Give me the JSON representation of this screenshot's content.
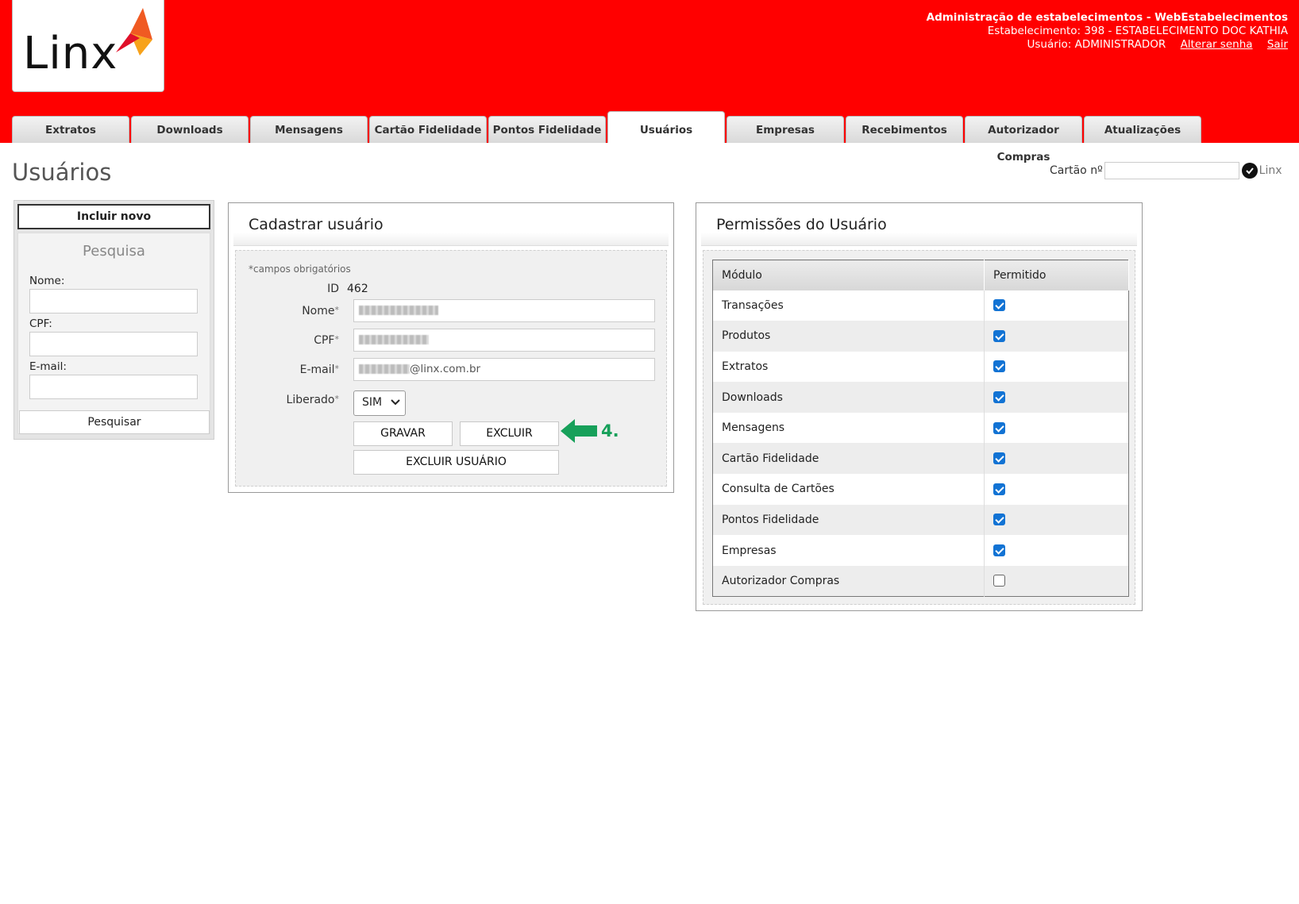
{
  "header": {
    "logo_text": "Linx",
    "title": "Administração de estabelecimentos - WebEstabelecimentos",
    "estabelecimento": "Estabelecimento: 398 - ESTABELECIMENTO DOC KATHIA",
    "usuario": "Usuário: ADMINISTRADOR",
    "alterar_senha": "Alterar senha",
    "sair": "Sair",
    "brand_color": "#ff0000"
  },
  "tabs": [
    {
      "label": "Extratos"
    },
    {
      "label": "Downloads"
    },
    {
      "label": "Mensagens"
    },
    {
      "label": "Cartão Fidelidade"
    },
    {
      "label": "Pontos Fidelidade"
    },
    {
      "label": "Usuários",
      "active": true
    },
    {
      "label": "Empresas"
    },
    {
      "label": "Recebimentos"
    },
    {
      "label": "Autorizador Compras"
    },
    {
      "label": "Atualizações"
    }
  ],
  "page": {
    "title": "Usuários",
    "cartao_label": "Cartão nº",
    "mini_logo": "Linx"
  },
  "sidebar": {
    "incluir_novo": "Incluir novo",
    "pesquisa_title": "Pesquisa",
    "nome_label": "Nome:",
    "cpf_label": "CPF:",
    "email_label": "E-mail:",
    "pesquisar_button": "Pesquisar"
  },
  "cadastro": {
    "title": "Cadastrar usuário",
    "obrigatorios": "*campos obrigatórios",
    "id_label": "ID",
    "id_value": "462",
    "nome_label": "Nome",
    "cpf_label": "CPF",
    "email_label": "E-mail",
    "email_suffix": "@linx.com.br",
    "liberado_label": "Liberado",
    "liberado_value": "SIM",
    "required_mark": "*",
    "gravar": "GRAVAR",
    "excluir": "EXCLUIR",
    "excluir_usuario": "EXCLUIR USUÁRIO",
    "annotation": "4.",
    "annotation_color": "#17a05a"
  },
  "permissoes": {
    "title": "Permissões do Usuário",
    "col_modulo": "Módulo",
    "col_permitido": "Permitido",
    "rows": [
      {
        "modulo": "Transações",
        "permitido": true
      },
      {
        "modulo": "Produtos",
        "permitido": true
      },
      {
        "modulo": "Extratos",
        "permitido": true
      },
      {
        "modulo": "Downloads",
        "permitido": true
      },
      {
        "modulo": "Mensagens",
        "permitido": true
      },
      {
        "modulo": "Cartão Fidelidade",
        "permitido": true
      },
      {
        "modulo": "Consulta de Cartões",
        "permitido": true
      },
      {
        "modulo": "Pontos Fidelidade",
        "permitido": true
      },
      {
        "modulo": "Empresas",
        "permitido": true
      },
      {
        "modulo": "Autorizador Compras",
        "permitido": false
      }
    ]
  }
}
